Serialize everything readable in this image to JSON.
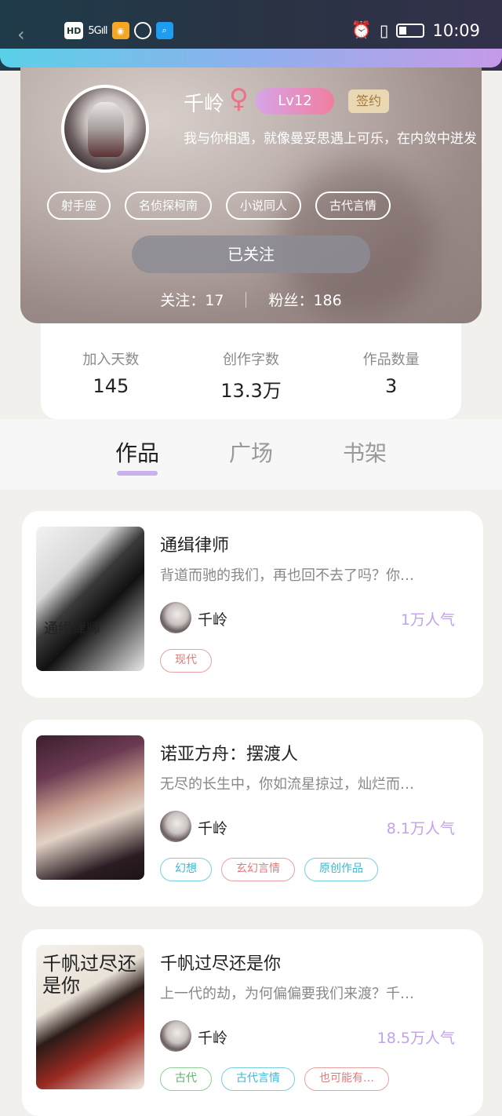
{
  "status_bar": {
    "time": "10:09",
    "network": "5G",
    "hd": "HD",
    "icons": [
      "back-arrow-icon",
      "hd-icon",
      "signal-icon",
      "weibo-icon",
      "ball-icon",
      "search-app-icon",
      "alarm-icon",
      "vibrate-icon",
      "battery-icon"
    ]
  },
  "profile": {
    "name": "千岭",
    "gender_symbol": "♀",
    "level": "Lv12",
    "signed_badge": "签约",
    "bio": "我与你相遇，就像曼妥思遇上可乐，在内敛中迸发",
    "tags": [
      "射手座",
      "名侦探柯南",
      "小说同人",
      "古代言情"
    ],
    "follow_button": "已关注",
    "following_label": "关注：17",
    "fans_label": "粉丝：186"
  },
  "stats": [
    {
      "label": "加入天数",
      "value": "145"
    },
    {
      "label": "创作字数",
      "value": "13.3万"
    },
    {
      "label": "作品数量",
      "value": "3"
    }
  ],
  "tabs": [
    {
      "label": "作品",
      "active": true
    },
    {
      "label": "广场",
      "active": false
    },
    {
      "label": "书架",
      "active": false
    }
  ],
  "books": [
    {
      "title": "通缉律师",
      "desc": "背道而驰的我们，再也回不去了吗？你…",
      "author": "千岭",
      "popularity": "1万人气",
      "cover_text": "通缉律师",
      "tags": [
        {
          "text": "现代",
          "color": "red"
        }
      ]
    },
    {
      "title": "诺亚方舟：摆渡人",
      "desc": "无尽的长生中，你如流星掠过，灿烂而…",
      "author": "千岭",
      "popularity": "8.1万人气",
      "cover_text": "",
      "tags": [
        {
          "text": "幻想",
          "color": "cyan"
        },
        {
          "text": "玄幻言情",
          "color": "red"
        },
        {
          "text": "原创作品",
          "color": "cyan"
        }
      ]
    },
    {
      "title": "千帆过尽还是你",
      "desc": "上一代的劫，为何偏偏要我们来渡？千…",
      "author": "千岭",
      "popularity": "18.5万人气",
      "cover_text": "千帆过尽还是你",
      "tags": [
        {
          "text": "古代",
          "color": "green"
        },
        {
          "text": "古代言情",
          "color": "cyan"
        },
        {
          "text": "也可能有…",
          "color": "red"
        }
      ]
    }
  ],
  "colors": {
    "level_gradient_start": "#d6a4e8",
    "level_gradient_end": "#f07fa0",
    "popularity": "#c2a2ea",
    "tab_indicator": "#c9b0ee",
    "tag_red": "#e07a7a",
    "tag_cyan": "#3fb8d4",
    "tag_green": "#5fb36b"
  }
}
